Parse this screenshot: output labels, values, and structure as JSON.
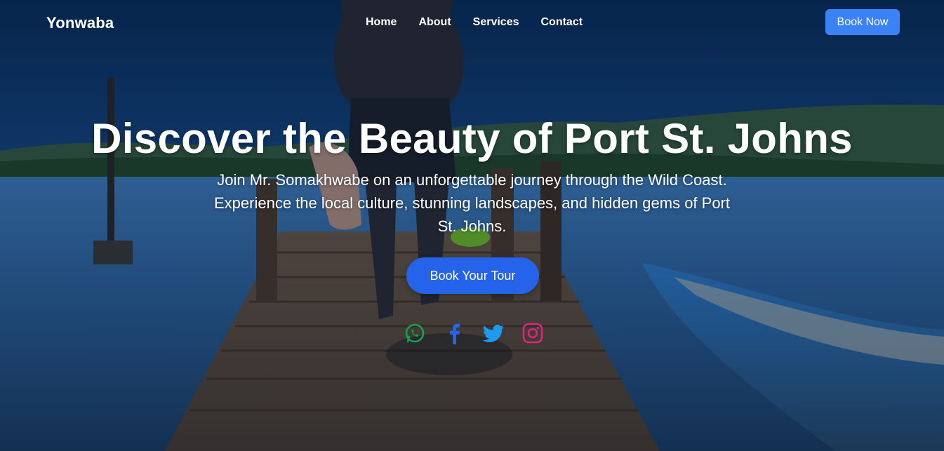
{
  "brand": {
    "name": "Yonwaba"
  },
  "nav": {
    "links": [
      "Home",
      "About",
      "Services",
      "Contact"
    ],
    "cta_label": "Book Now"
  },
  "hero": {
    "title": "Discover the Beauty of Port St. Johns",
    "subtitle": "Join Mr. Somakhwabe on an unforgettable journey through the Wild Coast. Experience the local culture, stunning landscapes, and hidden gems of Port St. Johns.",
    "cta_label": "Book Your Tour"
  },
  "socials": [
    {
      "icon": "whatsapp-icon",
      "color": "#16a34a"
    },
    {
      "icon": "facebook-icon",
      "color": "#2563eb"
    },
    {
      "icon": "twitter-icon",
      "color": "#1d9bf0"
    },
    {
      "icon": "instagram-icon",
      "color": "#db2777"
    }
  ],
  "colors": {
    "primary": "#3b82f6",
    "cta": "#2563eb",
    "text": "#ffffff"
  }
}
